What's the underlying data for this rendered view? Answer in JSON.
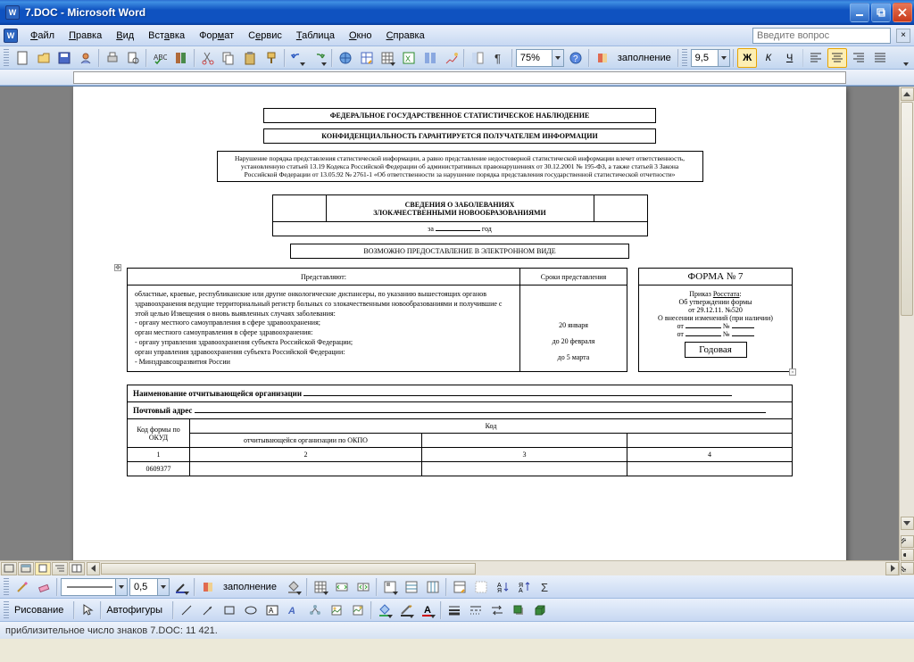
{
  "window": {
    "title": "7.DOC - Microsoft Word"
  },
  "menubar": {
    "items": [
      "Файл",
      "Правка",
      "Вид",
      "Вставка",
      "Формат",
      "Сервис",
      "Таблица",
      "Окно",
      "Справка"
    ],
    "question_placeholder": "Введите вопрос"
  },
  "toolbar1": {
    "zoom": "75%",
    "read_label": "заполнение"
  },
  "toolbar2": {
    "font_size": "9,5"
  },
  "document": {
    "box1": "ФЕДЕРАЛЬНОЕ ГОСУДАРСТВЕННОЕ СТАТИСТИЧЕСКОЕ НАБЛЮДЕНИЕ",
    "box2": "КОНФИДЕНЦИАЛЬНОСТЬ ГАРАНТИРУЕТСЯ ПОЛУЧАТЕЛЕМ ИНФОРМАЦИИ",
    "disclaimer": "Нарушение порядка представления статистической информации, а равно представление недостоверной статистической информации влечет ответственность, установленную статьей 13.19 Кодекса Российской Федерации об административных правонарушениях от 30.12.2001 № 195-ФЗ, а также статьей 3 Закона Российской Федерации от 13.05.92 № 2761-1 «Об ответственности за нарушение порядка представления государственной статистической отчетности»",
    "box3_line1": "СВЕДЕНИЯ О ЗАБОЛЕВАНИЯХ",
    "box3_line2": "ЗЛОКАЧЕСТВЕННЫМИ НОВООБРАЗОВАНИЯМИ",
    "period_za": "за",
    "period_god": "год",
    "box4": "ВОЗМОЖНО ПРЕДОСТАВЛЕНИЕ В ЭЛЕКТРОННОМ ВИДЕ",
    "table1": {
      "h1": "Представляют:",
      "h2": "Сроки представления",
      "h3": "ФОРМА № 7",
      "body": "областные, краевые, республиканские или другие онкологические диспансеры, по указанию вышестоящих органов здравоохранения ведущие территориальный регистр больных со злокачественными новообразованиями и получившие с этой целью Извещения о вновь выявленных случаях заболевания:\n- органу местного самоуправления в сфере здравоохранения;\nорган местного самоуправления в сфере здравоохранения:\n- органу управления здравоохранения субъекта Российской Федерации;\nорган управления здравоохранения субъекта Российской Федерации:\n- Минздравсоцразвития России",
      "dates": [
        "20 января",
        "до 20 февраля",
        "до 5 марта"
      ],
      "form_box": {
        "l1": "Приказ Росстата:",
        "l2": "Об утверждении формы",
        "l3": "от  29.12.11.        №520",
        "l4": "О внесении изменений (при наличии)",
        "l5a": "от",
        "l5b": "№",
        "btn": "Годовая"
      }
    },
    "org_label": "Наименование отчитывающейся организации",
    "addr_label": "Почтовый адрес",
    "codes": {
      "hdr_form": "Код формы по ОКУД",
      "hdr_main": "Код",
      "sub1": "отчитывающейся организации по ОКПО",
      "rownum": [
        "1",
        "2",
        "3",
        "4"
      ],
      "okud": "0609377"
    }
  },
  "bottom_toolbar": {
    "pt_value": "0,5",
    "style_label": "заполнение"
  },
  "draw_toolbar": {
    "label1": "Рисование",
    "label2": "Автофигуры"
  },
  "statusbar": {
    "text": "приблизительное число знаков 7.DOC: 11 421."
  }
}
